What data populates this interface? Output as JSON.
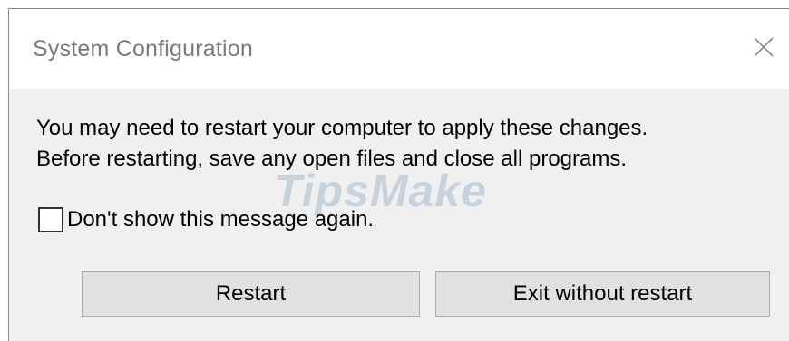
{
  "window": {
    "title": "System Configuration",
    "close_icon": "close-icon"
  },
  "message": {
    "line1": "You may need to restart your computer to apply these changes.",
    "line2": "Before restarting, save any open files and close all programs."
  },
  "watermark": {
    "text": "TipsMake"
  },
  "checkbox": {
    "label": "Don't show this message again.",
    "checked": false
  },
  "buttons": {
    "restart_label": "Restart",
    "exit_label": "Exit without restart"
  },
  "colors": {
    "dialog_bg": "#f0f0f0",
    "titlebar_bg": "#ffffff",
    "title_text": "#7a7a7a",
    "button_bg": "#e1e1e1",
    "button_border": "#adadad"
  }
}
